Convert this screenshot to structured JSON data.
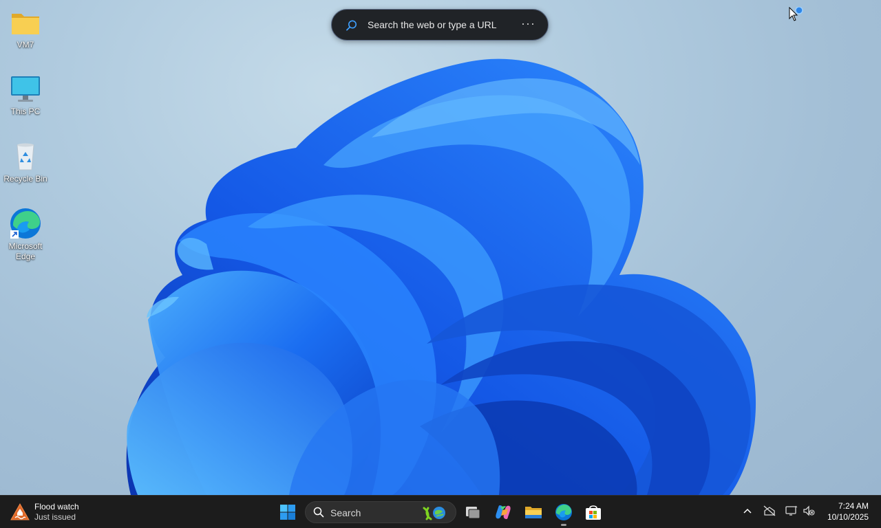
{
  "desktop": {
    "icons": [
      {
        "label": "VM7",
        "icon": "folder-icon"
      },
      {
        "label": "This PC",
        "icon": "monitor-icon"
      },
      {
        "label": "Recycle Bin",
        "icon": "recycle-bin-icon"
      },
      {
        "label": "Microsoft Edge",
        "icon": "edge-icon"
      }
    ]
  },
  "edge_search": {
    "placeholder": "Search the web or type a URL",
    "more_label": "···"
  },
  "taskbar": {
    "weather": {
      "title": "Flood watch",
      "subtitle": "Just issued",
      "icon": "flood-warning-icon"
    },
    "search": {
      "label": "Search"
    },
    "pinned_apps": [
      {
        "name": "Start",
        "icon": "windows-start-icon"
      },
      {
        "name": "Task view",
        "icon": "task-view-icon"
      },
      {
        "name": "Copilot",
        "icon": "copilot-icon"
      },
      {
        "name": "File Explorer",
        "icon": "folder-icon"
      },
      {
        "name": "Microsoft Edge",
        "icon": "edge-icon",
        "active": true
      },
      {
        "name": "Microsoft Store",
        "icon": "store-icon"
      }
    ],
    "tray": {
      "icons": [
        "chevron-up-icon",
        "network-off-icon",
        "display-icon",
        "volume-muted-icon"
      ]
    },
    "clock": {
      "time": "7:24 AM",
      "date": "10/10/2025"
    }
  },
  "colors": {
    "taskbar_bg": "#1c1c1c",
    "wallpaper_blue": "#1a6ff0",
    "edge_bar_bg": "#202327",
    "windows_blue": "#2d9cf0"
  }
}
